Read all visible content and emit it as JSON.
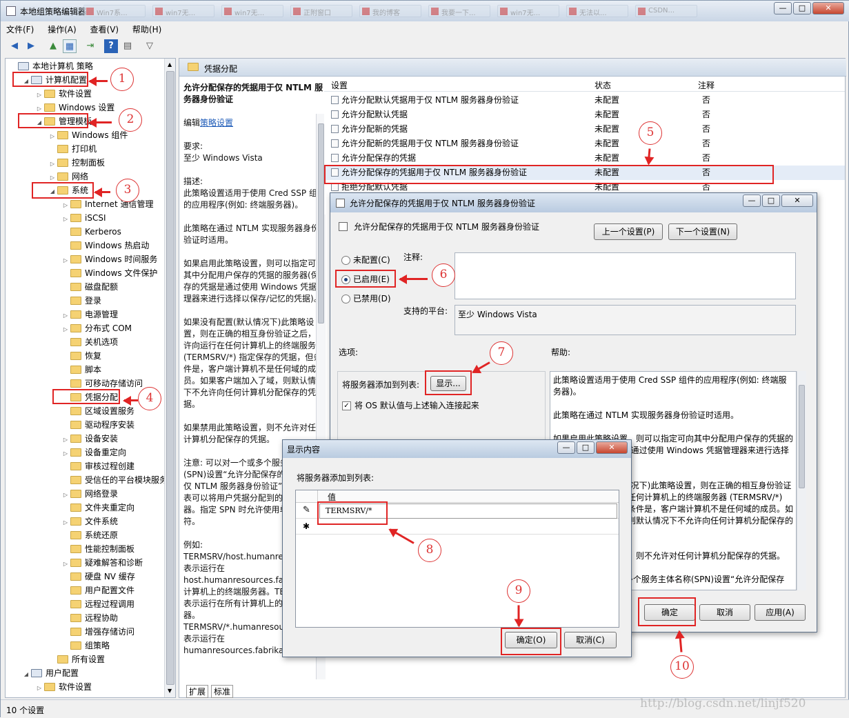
{
  "app": {
    "title": "本地组策略编辑器",
    "bg_tabs": [
      "Win7系...",
      "win7无...",
      "win7无...",
      "正附窗口",
      "我的博客",
      "我要一下...",
      "win7无...",
      "无法以...",
      "CSDN..."
    ]
  },
  "window_buttons": {
    "min": "—",
    "max": "□",
    "close": "✕"
  },
  "menu": [
    "文件(F)",
    "操作(A)",
    "查看(V)",
    "帮助(H)"
  ],
  "tree": {
    "items": [
      {
        "label": "本地计算机 策略",
        "level": 0,
        "arrow": ""
      },
      {
        "label": "计算机配置",
        "level": 1,
        "arrow": "◢"
      },
      {
        "label": "软件设置",
        "level": 2,
        "arrow": "▷"
      },
      {
        "label": "Windows 设置",
        "level": 2,
        "arrow": "▷"
      },
      {
        "label": "管理模板",
        "level": 2,
        "arrow": "◢"
      },
      {
        "label": "Windows 组件",
        "level": 3,
        "arrow": "▷"
      },
      {
        "label": "打印机",
        "level": 3,
        "arrow": ""
      },
      {
        "label": "控制面板",
        "level": 3,
        "arrow": "▷"
      },
      {
        "label": "网络",
        "level": 3,
        "arrow": "▷"
      },
      {
        "label": "系统",
        "level": 3,
        "arrow": "◢"
      },
      {
        "label": "Internet 通信管理",
        "level": 4,
        "arrow": "▷"
      },
      {
        "label": "iSCSI",
        "level": 4,
        "arrow": "▷"
      },
      {
        "label": "Kerberos",
        "level": 4,
        "arrow": ""
      },
      {
        "label": "Windows 热启动",
        "level": 4,
        "arrow": ""
      },
      {
        "label": "Windows 时间服务",
        "level": 4,
        "arrow": "▷"
      },
      {
        "label": "Windows 文件保护",
        "level": 4,
        "arrow": ""
      },
      {
        "label": "磁盘配额",
        "level": 4,
        "arrow": ""
      },
      {
        "label": "登录",
        "level": 4,
        "arrow": ""
      },
      {
        "label": "电源管理",
        "level": 4,
        "arrow": "▷"
      },
      {
        "label": "分布式 COM",
        "level": 4,
        "arrow": "▷"
      },
      {
        "label": "关机选项",
        "level": 4,
        "arrow": ""
      },
      {
        "label": "恢复",
        "level": 4,
        "arrow": ""
      },
      {
        "label": "脚本",
        "level": 4,
        "arrow": ""
      },
      {
        "label": "可移动存储访问",
        "level": 4,
        "arrow": ""
      },
      {
        "label": "凭据分配",
        "level": 4,
        "arrow": ""
      },
      {
        "label": "区域设置服务",
        "level": 4,
        "arrow": ""
      },
      {
        "label": "驱动程序安装",
        "level": 4,
        "arrow": ""
      },
      {
        "label": "设备安装",
        "level": 4,
        "arrow": "▷"
      },
      {
        "label": "设备重定向",
        "level": 4,
        "arrow": "▷"
      },
      {
        "label": "审核过程创建",
        "level": 4,
        "arrow": ""
      },
      {
        "label": "受信任的平台模块服务",
        "level": 4,
        "arrow": ""
      },
      {
        "label": "网络登录",
        "level": 4,
        "arrow": "▷"
      },
      {
        "label": "文件夹重定向",
        "level": 4,
        "arrow": ""
      },
      {
        "label": "文件系统",
        "level": 4,
        "arrow": "▷"
      },
      {
        "label": "系统还原",
        "level": 4,
        "arrow": ""
      },
      {
        "label": "性能控制面板",
        "level": 4,
        "arrow": ""
      },
      {
        "label": "疑难解答和诊断",
        "level": 4,
        "arrow": "▷"
      },
      {
        "label": "硬盘 NV 缓存",
        "level": 4,
        "arrow": ""
      },
      {
        "label": "用户配置文件",
        "level": 4,
        "arrow": ""
      },
      {
        "label": "远程过程调用",
        "level": 4,
        "arrow": ""
      },
      {
        "label": "远程协助",
        "level": 4,
        "arrow": ""
      },
      {
        "label": "增强存储访问",
        "level": 4,
        "arrow": ""
      },
      {
        "label": "组策略",
        "level": 4,
        "arrow": ""
      },
      {
        "label": "所有设置",
        "level": 3,
        "arrow": ""
      },
      {
        "label": "用户配置",
        "level": 1,
        "arrow": "◢"
      },
      {
        "label": "软件设置",
        "level": 2,
        "arrow": "▷"
      }
    ]
  },
  "right": {
    "header": "凭据分配",
    "desc": {
      "title": "允许分配保存的凭据用于仅 NTLM 服务器身份验证",
      "edit_prefix": "编辑",
      "edit_link": "策略设置",
      "req_label": "要求:",
      "req_value": "至少 Windows Vista",
      "desc_label": "描述:",
      "p1": "此策略设置适用于使用 Cred SSP 组件的应用程序(例如: 终端服务器)。",
      "p2": "此策略在通过 NTLM 实现服务器身份验证时适用。",
      "p3": "如果启用此策略设置，则可以指定可向其中分配用户保存的凭据的服务器(保存的凭据是通过使用 Windows 凭据管理器来进行选择以保存/记忆的凭据)。",
      "p4": "如果没有配置(默认情况下)此策略设置，则在正确的相互身份验证之后，允许向运行在任何计算机上的终端服务器 (TERMSRV/*) 指定保存的凭据，但条件是，客户端计算机不是任何域的成员。如果客户端加入了域，则默认情况下不允许向任何计算机分配保存的凭据。",
      "p5": "如果禁用此策略设置，则不允许对任何计算机分配保存的凭据。",
      "p6": "注意: 可以对一个或多个服务主体名称(SPN)设置“允许分配保存的凭据用于仅 NTLM 服务器身份验证”。SPN 代表可以将用户凭据分配到的目标服务器。指定 SPN 时允许使用单个通配符。",
      "p7_label": "例如:",
      "p7": "TERMSRV/host.humanresources.fabrikam.com 表示运行在 host.humanresources.fabrikam.com 计算机上的终端服务器。TERMSRV/* 表示运行在所有计算机上的终端服务器。TERMSRV/*.humanresources.fabrikam.com 表示运行在 humanresources.fabrikam.com"
    },
    "columns": [
      "设置",
      "状态",
      "注释"
    ],
    "rows": [
      {
        "name": "允许分配默认凭据用于仅 NTLM 服务器身份验证",
        "state": "未配置",
        "note": "否"
      },
      {
        "name": "允许分配默认凭据",
        "state": "未配置",
        "note": "否"
      },
      {
        "name": "允许分配新的凭据",
        "state": "未配置",
        "note": "否"
      },
      {
        "name": "允许分配新的凭据用于仅 NTLM 服务器身份验证",
        "state": "未配置",
        "note": "否"
      },
      {
        "name": "允许分配保存的凭据",
        "state": "未配置",
        "note": "否"
      },
      {
        "name": "允许分配保存的凭据用于仅 NTLM 服务器身份验证",
        "state": "未配置",
        "note": "否"
      },
      {
        "name": "拒绝分配默认凭据",
        "state": "未配置",
        "note": "否"
      }
    ],
    "tabs": [
      "扩展",
      "标准"
    ]
  },
  "policy_dialog": {
    "title": "允许分配保存的凭据用于仅 NTLM 服务器身份验证",
    "heading": "允许分配保存的凭据用于仅 NTLM 服务器身份验证",
    "prev": "上一个设置(P)",
    "next": "下一个设置(N)",
    "opt_not_configured": "未配置(C)",
    "opt_enabled": "已启用(E)",
    "opt_disabled": "已禁用(D)",
    "comment_label": "注释:",
    "platform_label": "支持的平台:",
    "platform_value": "至少 Windows Vista",
    "options_label": "选项:",
    "help_label": "帮助:",
    "add_servers": "将服务器添加到列表:",
    "show_btn": "显示...",
    "concat_label": "将 OS 默认值与上述输入连接起来",
    "help_text": {
      "h1": "此策略设置适用于使用 Cred SSP 组件的应用程序(例如: 终端服务器)。",
      "h2": "此策略在通过 NTLM 实现服务器身份验证时适用。",
      "h3": "如果启用此策略设置，则可以指定可向其中分配用户保存的凭据的服务器(保存的凭据是通过使用 Windows 凭据管理器来进行选择以保存/记忆的凭据)。",
      "h4": "如果没有配置(默认情况下)此策略设置，则在正确的相互身份验证之后，允许向运行在任何计算机上的终端服务器 (TERMSRV/*) 指定保存的凭据，但条件是，客户端计算机不是任何域的成员。如果客户端加入了域，则默认情况下不允许向任何计算机分配保存的凭据。",
      "h5": "如果禁用此策略设置，则不允许对任何计算机分配保存的凭据。",
      "h6": "注意: 可以对一个或多个服务主体名称(SPN)设置“允许分配保存"
    },
    "ok": "确定",
    "cancel": "取消",
    "apply": "应用(A)"
  },
  "show_dialog": {
    "title": "显示内容",
    "label": "将服务器添加到列表:",
    "col": "值",
    "value": "TERMSRV/*",
    "row_edit_icon": "✎",
    "row_new_icon": "✱",
    "ok": "确定(O)",
    "cancel": "取消(C)"
  },
  "callouts": [
    "1",
    "2",
    "3",
    "4",
    "5",
    "6",
    "7",
    "8",
    "9",
    "10"
  ],
  "status": "10 个设置",
  "watermark": "http://blog.csdn.net/linjf520"
}
